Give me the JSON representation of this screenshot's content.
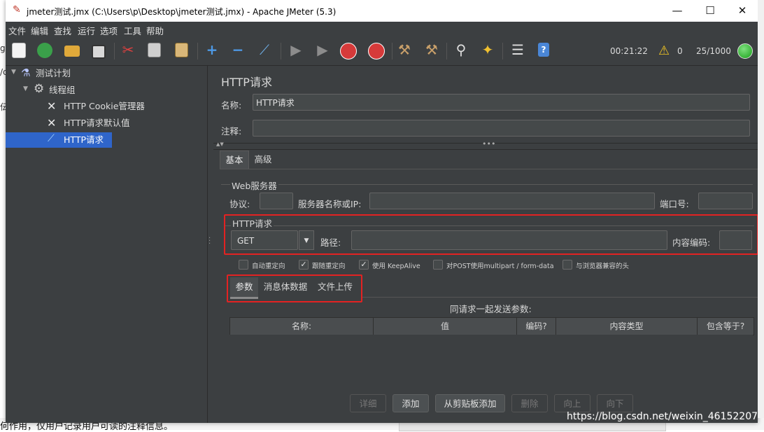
{
  "window": {
    "title": "jmeter测试.jmx (C:\\Users\\p\\Desktop\\jmeter测试.jmx) - Apache JMeter (5.3)",
    "minimize": "—",
    "maximize": "☐",
    "close": "✕"
  },
  "menu": [
    "文件",
    "编辑",
    "查找",
    "运行",
    "选项",
    "工具",
    "帮助"
  ],
  "status": {
    "timer": "00:21:22",
    "warnings": "0",
    "threads": "25/1000"
  },
  "tree": {
    "items": [
      {
        "label": "测试计划",
        "icon": "flask-icon"
      },
      {
        "label": "线程组",
        "icon": "gear-icon"
      },
      {
        "label": "HTTP Cookie管理器",
        "icon": "tools-icon"
      },
      {
        "label": "HTTP请求默认值",
        "icon": "tools-icon"
      },
      {
        "label": "HTTP请求",
        "icon": "pipette-icon"
      }
    ]
  },
  "sampler": {
    "heading": "HTTP请求",
    "name_label": "名称:",
    "name_value": "HTTP请求",
    "comment_label": "注释:",
    "comment_value": ""
  },
  "tabs": [
    "基本",
    "高级"
  ],
  "web_server": {
    "legend": "Web服务器",
    "protocol_label": "协议:",
    "server_label": "服务器名称或IP:",
    "port_label": "端口号:"
  },
  "http_request": {
    "legend": "HTTP请求",
    "method": "GET",
    "path_label": "路径:",
    "encoding_label": "内容编码:"
  },
  "checkboxes": [
    {
      "label": "自动重定向",
      "checked": false
    },
    {
      "label": "跟随重定向",
      "checked": true
    },
    {
      "label": "使用 KeepAlive",
      "checked": true
    },
    {
      "label": "对POST使用multipart / form-data",
      "checked": false
    },
    {
      "label": "与浏览器兼容的头",
      "checked": false
    }
  ],
  "sub_tabs": [
    "参数",
    "消息体数据",
    "文件上传"
  ],
  "params": {
    "caption": "同请求一起发送参数:",
    "columns": [
      "名称:",
      "值",
      "编码?",
      "内容类型",
      "包含等于?"
    ]
  },
  "buttons": [
    {
      "label": "详细",
      "enabled": false
    },
    {
      "label": "添加",
      "enabled": true
    },
    {
      "label": "从剪贴板添加",
      "enabled": true
    },
    {
      "label": "删除",
      "enabled": false
    },
    {
      "label": "向上",
      "enabled": false
    },
    {
      "label": "向下",
      "enabled": false
    }
  ],
  "background": {
    "bottom_text": "何作用，仅用户记录用户可读的注释信息。",
    "watermark": "https://blog.csdn.net/weixin_46152207",
    "left_fragments": [
      "g",
      "/c",
      "伝"
    ]
  },
  "colors": {
    "window_bg": "#3c3f41",
    "selection": "#2f65ca",
    "highlight_box": "#e32222"
  }
}
